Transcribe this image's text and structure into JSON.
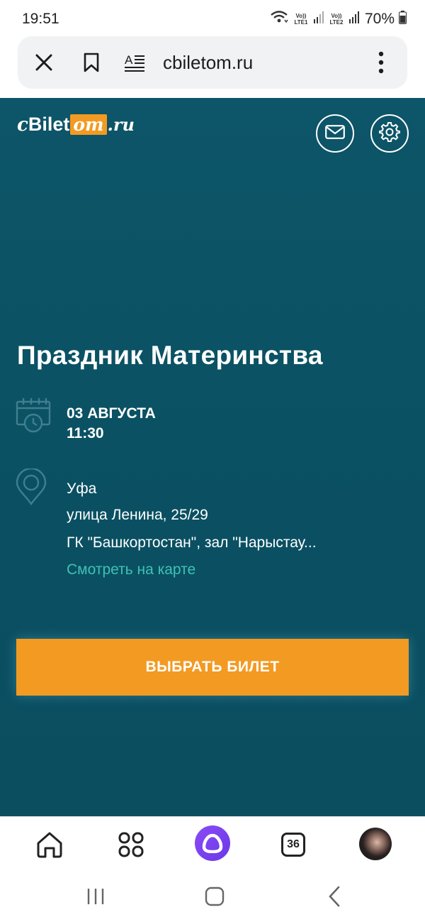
{
  "status_bar": {
    "time": "19:51",
    "sim1_label": "Vo)) LTE1",
    "sim2_label": "Vo)) LTE2",
    "battery": "70%"
  },
  "browser": {
    "url": "cbiletom.ru",
    "icons": [
      "close-icon",
      "bookmark-icon",
      "reader-mode-icon",
      "more-vert-icon"
    ]
  },
  "logo": {
    "part1": "c",
    "part2": "Bilet",
    "part3": "om",
    "part4": ".ru"
  },
  "header_icons": [
    "mail-icon",
    "settings-icon"
  ],
  "event": {
    "title": "Праздник Материнства",
    "date": "03 АВГУСТА",
    "time": "11:30",
    "city": "Уфа",
    "street": "улица Ленина, 25/29",
    "venue": "ГК \"Башкортостан\", зал \"Нарыстау...",
    "map_link": "Смотреть на карте",
    "buy_button": "ВЫБРАТЬ БИЛЕТ"
  },
  "bottom_nav": {
    "tabs_count": "36",
    "icons": [
      "home-icon",
      "apps-grid-icon",
      "alice-assistant-icon",
      "tabs-icon",
      "avatar"
    ]
  },
  "colors": {
    "hero_bg": "#0b5164",
    "accent_orange": "#f39a22",
    "link_teal": "#3fc1b4",
    "alice_purple": "#7a43f0"
  }
}
